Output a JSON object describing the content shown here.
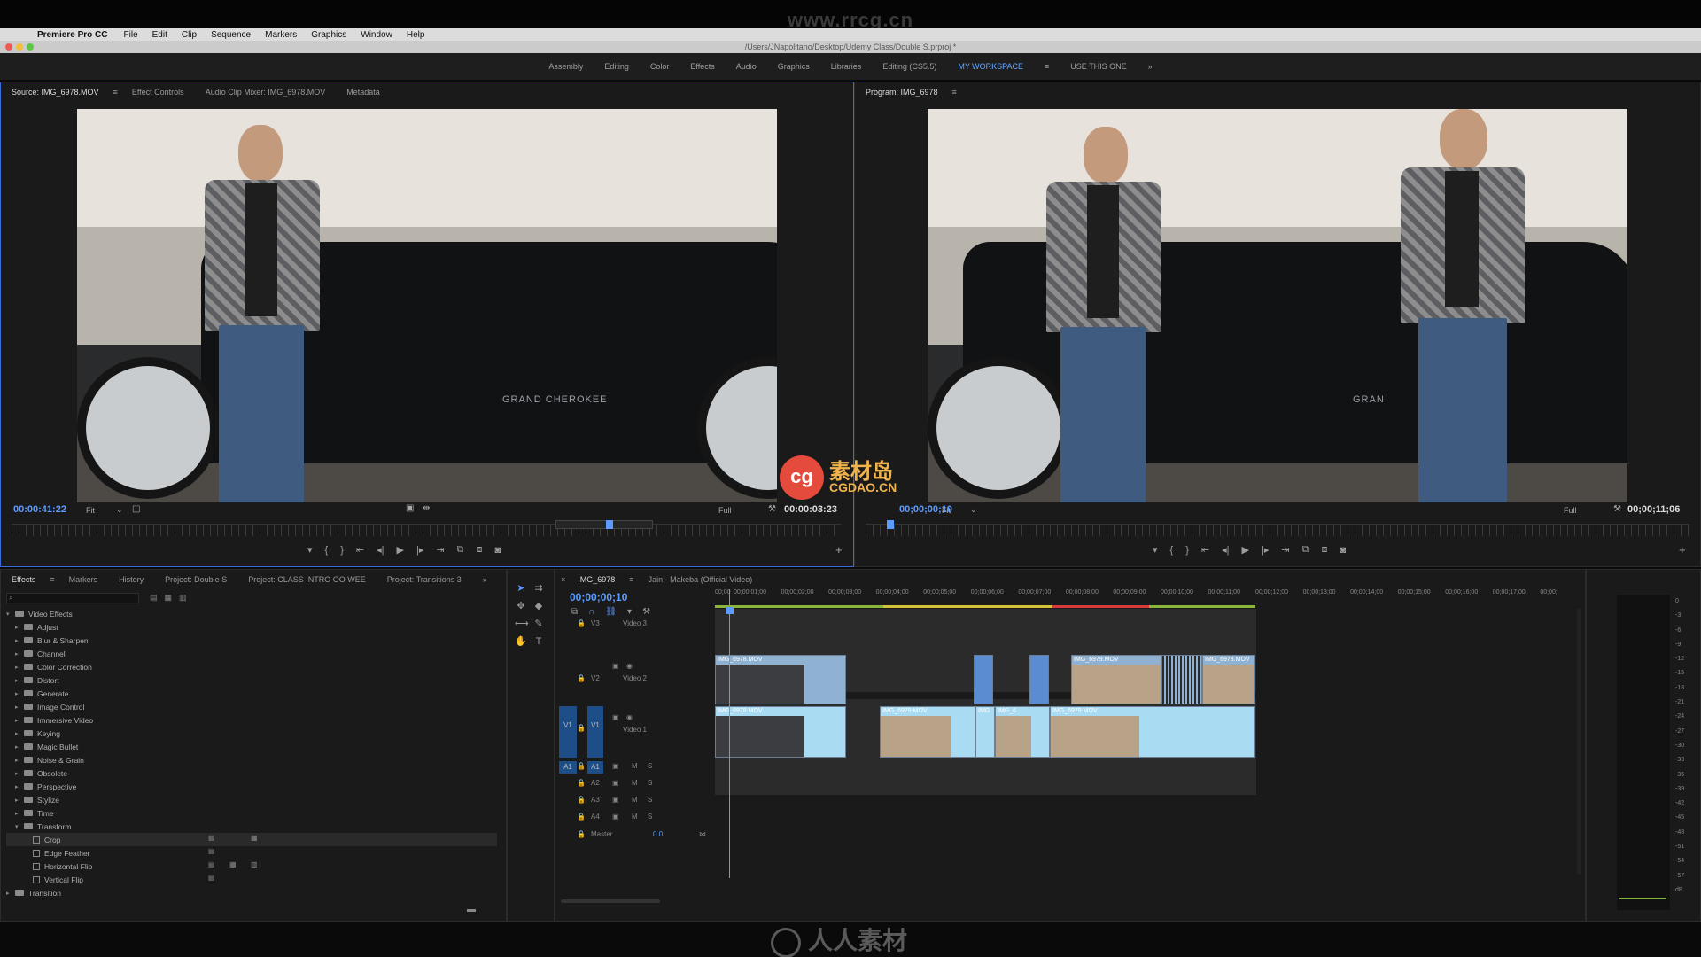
{
  "watermark_top": "www.rrcg.cn",
  "menubar": {
    "app": "Premiere Pro CC",
    "items": [
      "File",
      "Edit",
      "Clip",
      "Sequence",
      "Markers",
      "Graphics",
      "Window",
      "Help"
    ]
  },
  "titlebar": "/Users/JNapolitano/Desktop/Udemy Class/Double S.prproj *",
  "workspaces": [
    "Assembly",
    "Editing",
    "Color",
    "Effects",
    "Audio",
    "Graphics",
    "Libraries",
    "Editing (CS5.5)",
    "MY WORKSPACE",
    "USE THIS ONE"
  ],
  "workspace_more": "»",
  "source": {
    "tabs": [
      "Source: IMG_6978.MOV",
      "Effect Controls",
      "Audio Clip Mixer: IMG_6978.MOV",
      "Metadata"
    ],
    "timecode_in": "00:00:41:22",
    "fit": "Fit",
    "resolution": "Full",
    "duration": "00:00:03:23",
    "truck_text": "GRAND CHEROKEE"
  },
  "program": {
    "tabs": [
      "Program: IMG_6978"
    ],
    "timecode": "00;00;00;10",
    "fit": "Fit",
    "resolution": "Full",
    "duration": "00;00;11;06",
    "truck_text": "GRAN"
  },
  "effects_panel": {
    "tabs": [
      "Effects",
      "Markers",
      "History",
      "Project: Double S",
      "Project: CLASS INTRO OO WEE",
      "Project: Transitions 3"
    ],
    "root": "Video Effects",
    "folders": [
      "Adjust",
      "Blur & Sharpen",
      "Channel",
      "Color Correction",
      "Distort",
      "Generate",
      "Image Control",
      "Immersive Video",
      "Keying",
      "Magic Bullet",
      "Noise & Grain",
      "Obsolete",
      "Perspective",
      "Stylize",
      "Time",
      "Transform"
    ],
    "transform_items": [
      "Crop",
      "Edge Feather",
      "Horizontal Flip",
      "Vertical Flip"
    ],
    "last": "Transition"
  },
  "timeline": {
    "tabs": [
      "IMG_6978",
      "Jain - Makeba (Official Video)"
    ],
    "timecode": "00;00;00;10",
    "ruler": [
      "00;00",
      "00;00;01;00",
      "00;00;02;00",
      "00;00;03;00",
      "00;00;04;00",
      "00;00;05;00",
      "00;00;06;00",
      "00;00;07;00",
      "00;00;08;00",
      "00;00;09;00",
      "00;00;10;00",
      "00;00;11;00",
      "00;00;12;00",
      "00;00;13;00",
      "00;00;14;00",
      "00;00;15;00",
      "00;00;16;00",
      "00;00;17;00",
      "00;00;"
    ],
    "tracks": {
      "v3": "V3",
      "v3_name": "Video 3",
      "v2": "V2",
      "v2_name": "Video 2",
      "v1": "V1",
      "v1_name": "Video 1",
      "a1": "A1",
      "a2": "A2",
      "a3": "A3",
      "a4": "A4",
      "master": "Master",
      "master_val": "0.0"
    },
    "clips": {
      "v2_1": "IMG_6978.MOV",
      "v2_2": "IMG_6979.MOV",
      "v2_3": "IMG_6978.MOV",
      "v1_1": "IMG_6978.MOV",
      "v1_2": "IMG_6979.MOV",
      "v1_3": "IMG",
      "v1_4": "IMG_6",
      "v1_5": "IMG_6979.MOV"
    },
    "m": "M",
    "s": "S"
  },
  "meter_scale": [
    "0",
    "-3",
    "-6",
    "-9",
    "-12",
    "-15",
    "-18",
    "-21",
    "-24",
    "-27",
    "-30",
    "-33",
    "-36",
    "-39",
    "-42",
    "-45",
    "-48",
    "-51",
    "-54",
    "-57",
    "dB"
  ],
  "logo_center": {
    "cg": "cg",
    "cn": "素材岛",
    "sub": "CGDAO.CN"
  },
  "logo_bottom": "人人素材",
  "colors": {
    "accent": "#3b6bd8",
    "timecode": "#5d9cff",
    "clip_video": "#8fb2d3",
    "clip_audio": "#a9dbf3"
  }
}
